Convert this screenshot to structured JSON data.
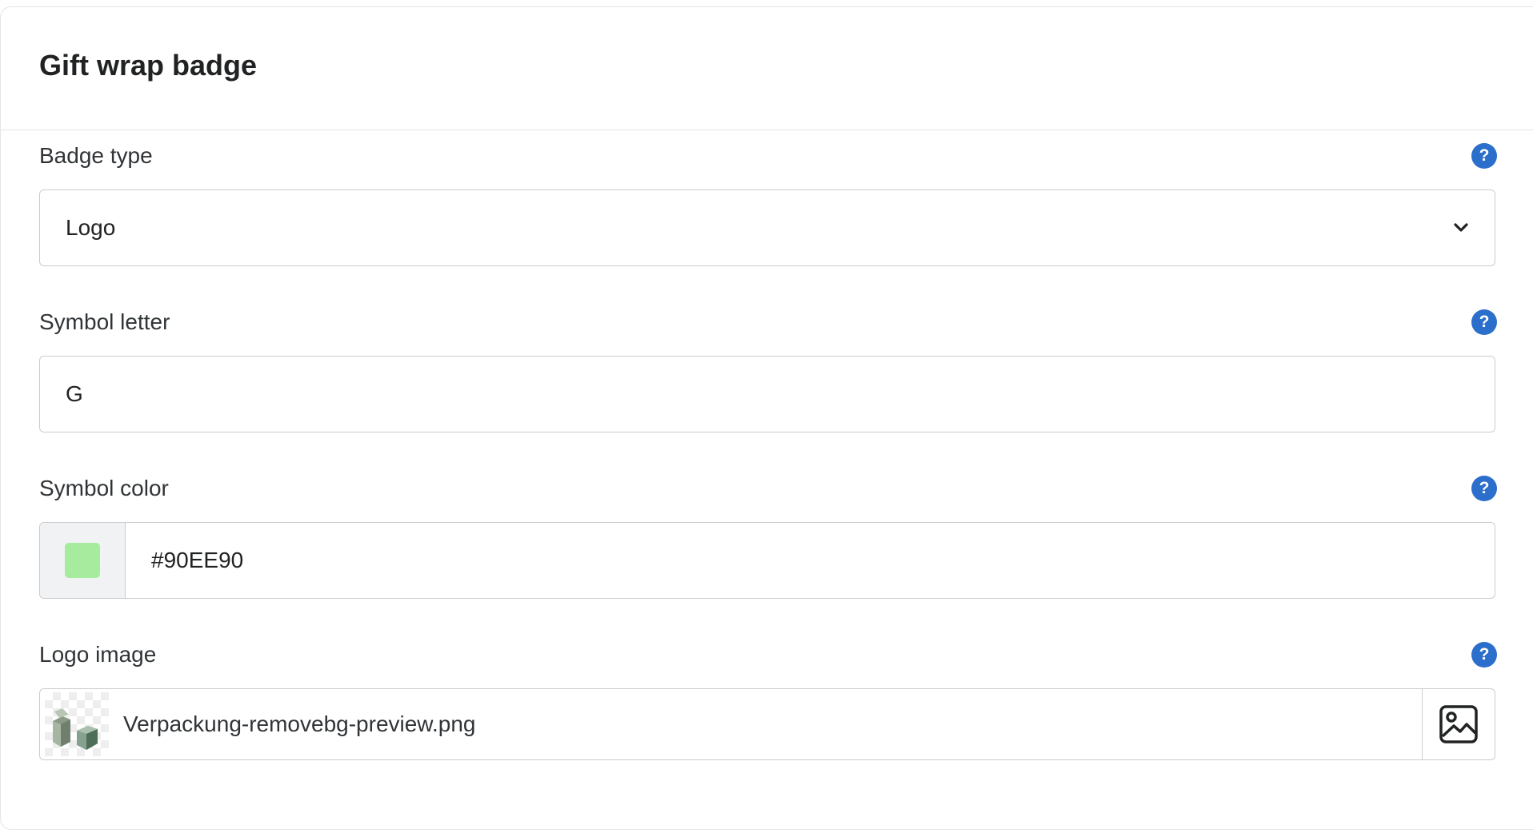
{
  "card": {
    "title": "Gift wrap badge"
  },
  "fields": {
    "badge_type": {
      "label": "Badge type",
      "value": "Logo",
      "help_icon": "question-circle-icon"
    },
    "symbol_letter": {
      "label": "Symbol letter",
      "value": "G",
      "help_icon": "question-circle-icon"
    },
    "symbol_color": {
      "label": "Symbol color",
      "value": "#90EE90",
      "swatch_color": "#A6EB9E",
      "help_icon": "question-circle-icon"
    },
    "logo_image": {
      "label": "Logo image",
      "file_name": "Verpackung-removebg-preview.png",
      "help_icon": "question-circle-icon",
      "picker_icon": "image-icon"
    }
  },
  "help_glyph": "?",
  "colors": {
    "help_icon": "#2C6ECB",
    "border": "#C9CCCF",
    "divider": "#E3E5E8"
  }
}
